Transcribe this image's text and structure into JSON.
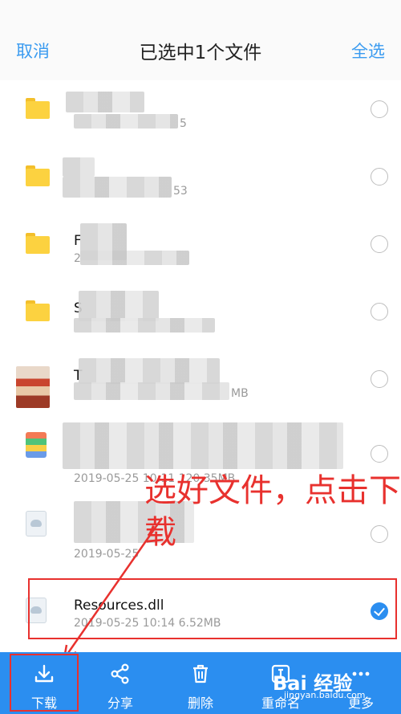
{
  "header": {
    "cancel": "取消",
    "title": "已选中1个文件",
    "select_all": "全选"
  },
  "files": [
    {
      "name": "",
      "meta": "5",
      "type": "folder",
      "selected": false
    },
    {
      "name": "",
      "meta": "53",
      "type": "folder",
      "selected": false
    },
    {
      "name": "F",
      "meta": "2",
      "type": "folder",
      "selected": false
    },
    {
      "name": "S",
      "meta": "",
      "type": "folder",
      "selected": false
    },
    {
      "name": "T",
      "meta": "MB",
      "type": "image",
      "selected": false
    },
    {
      "name": "",
      "meta": "2019-05-25  10:11  120.35MB",
      "type": "zip",
      "selected": false
    },
    {
      "name": "",
      "meta": "2019-05-25",
      "type": "doc",
      "selected": false
    },
    {
      "name": "Resources.dll",
      "meta": "2019-05-25  10:14  6.52MB",
      "type": "doc",
      "selected": true
    }
  ],
  "annotation": {
    "text": "选好文件，点击下载"
  },
  "toolbar": {
    "download": "下载",
    "share": "分享",
    "delete": "删除",
    "rename": "重命名",
    "more": "更多"
  },
  "watermark": {
    "logo": "Bai 经验",
    "url": "jingyan.baidu.com"
  },
  "colors": {
    "accent": "#2b8ef0",
    "annotation": "#e8312e",
    "folder": "#fcd240"
  }
}
